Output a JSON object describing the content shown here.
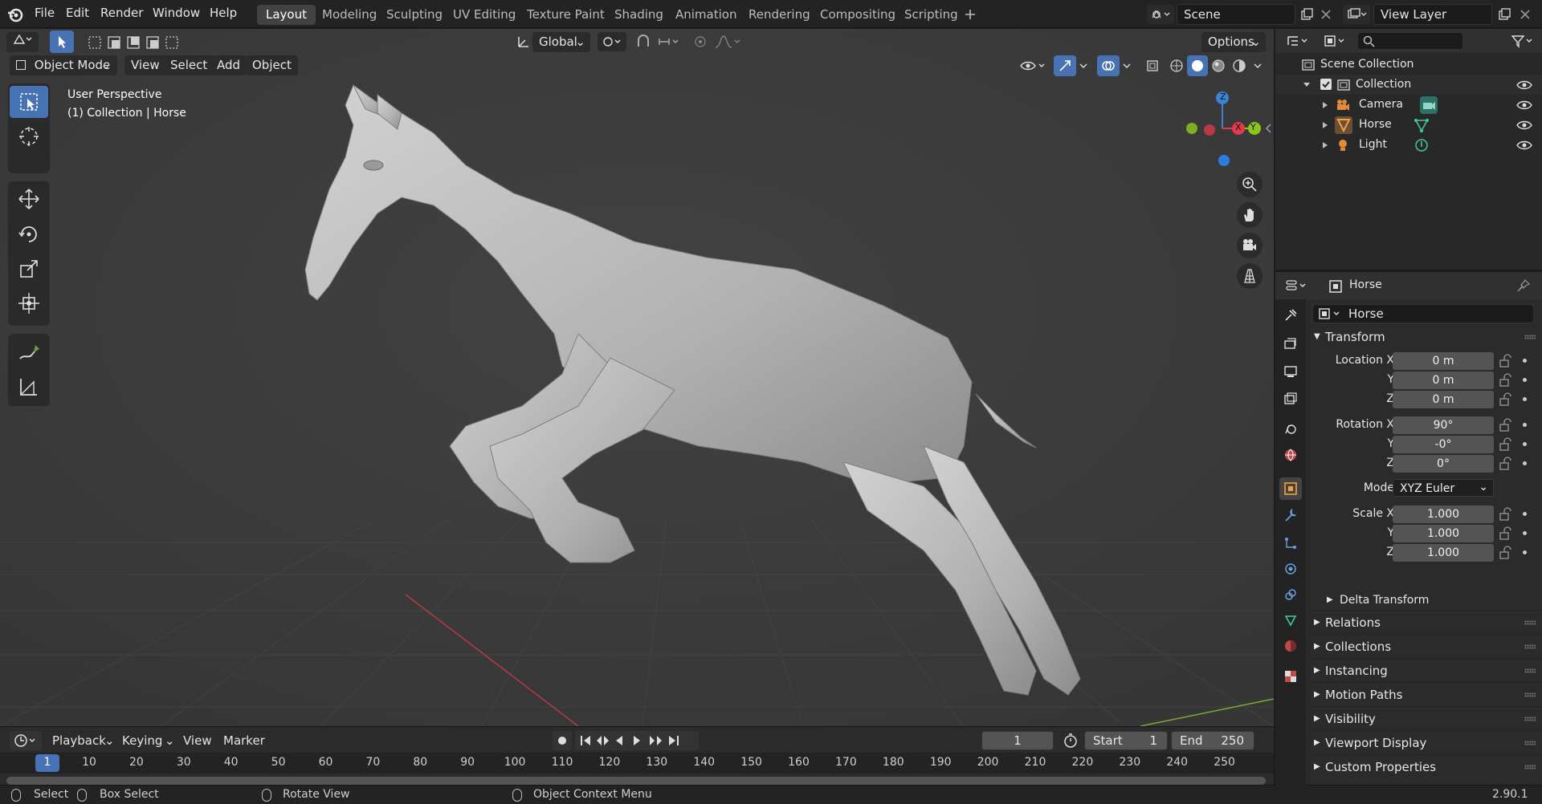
{
  "menu": [
    "File",
    "Edit",
    "Render",
    "Window",
    "Help"
  ],
  "workspaces": [
    "Layout",
    "Modeling",
    "Sculpting",
    "UV Editing",
    "Texture Paint",
    "Shading",
    "Animation",
    "Rendering",
    "Compositing",
    "Scripting"
  ],
  "scene": "Scene",
  "view_layer": "View Layer",
  "header": {
    "orientation": "Global",
    "options": "Options",
    "mode": "Object Mode",
    "view_menu": [
      "View",
      "Select",
      "Add",
      "Object"
    ]
  },
  "viewport": {
    "overlay_line1": "User Perspective",
    "overlay_line2": "(1) Collection | Horse",
    "gizmo": {
      "z": "Z",
      "y": "Y",
      "x": "X"
    }
  },
  "outliner": {
    "root": "Scene Collection",
    "collection": "Collection",
    "items": [
      "Camera",
      "Horse",
      "Light"
    ]
  },
  "properties": {
    "object_name": "Horse",
    "data_name": "Horse",
    "transform_title": "Transform",
    "location": {
      "label_x": "Location X",
      "label_y": "Y",
      "label_z": "Z",
      "x": "0 m",
      "y": "0 m",
      "z": "0 m"
    },
    "rotation": {
      "label_x": "Rotation X",
      "label_y": "Y",
      "label_z": "Z",
      "x": "90°",
      "y": "-0°",
      "z": "0°"
    },
    "mode_label": "Mode",
    "mode": "XYZ Euler",
    "scale": {
      "label_x": "Scale X",
      "label_y": "Y",
      "label_z": "Z",
      "x": "1.000",
      "y": "1.000",
      "z": "1.000"
    },
    "delta": "Delta Transform",
    "sections": [
      "Relations",
      "Collections",
      "Instancing",
      "Motion Paths",
      "Visibility",
      "Viewport Display",
      "Custom Properties"
    ]
  },
  "timeline": {
    "menus": [
      "Playback",
      "Keying",
      "View",
      "Marker"
    ],
    "current_frame": "1",
    "start_label": "Start",
    "start": "1",
    "end_label": "End",
    "end": "250",
    "frames": [
      "1",
      "10",
      "20",
      "30",
      "40",
      "50",
      "60",
      "70",
      "80",
      "90",
      "100",
      "110",
      "120",
      "130",
      "140",
      "150",
      "160",
      "170",
      "180",
      "190",
      "200",
      "210",
      "220",
      "230",
      "240",
      "250"
    ]
  },
  "status": {
    "select": "Select",
    "box_select": "Box Select",
    "rotate_view": "Rotate View",
    "context_menu": "Object Context Menu",
    "version": "2.90.1"
  },
  "colors": {
    "accent": "#4772b3",
    "x_axis": "#e13a4c",
    "y_axis": "#8ac51a",
    "z_axis": "#3b82d4",
    "active_frame": "#4772b3"
  }
}
